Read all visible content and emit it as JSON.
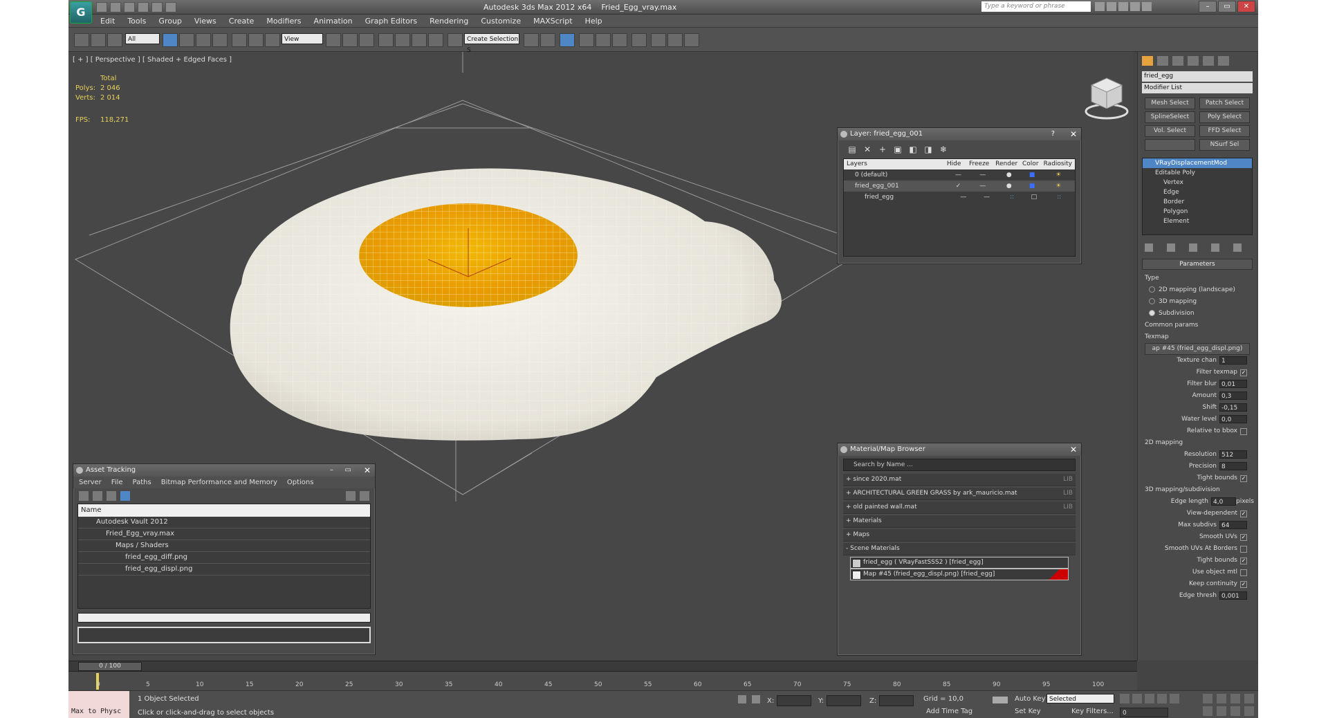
{
  "titlebar": {
    "app_title": "Autodesk 3ds Max  2012 x64",
    "file_title": "Fried_Egg_vray.max",
    "search_placeholder": "Type a keyword or phrase"
  },
  "menu": [
    "Edit",
    "Tools",
    "Group",
    "Views",
    "Create",
    "Modifiers",
    "Animation",
    "Graph Editors",
    "Rendering",
    "Customize",
    "MAXScript",
    "Help"
  ],
  "toolbar": {
    "filter_value": "All",
    "ref_coord_value": "View",
    "selection_set_value": "Create Selection S"
  },
  "viewport": {
    "label": "[ + ] [ Perspective ] [ Shaded + Edged Faces ]",
    "stats_header": "Total",
    "polys_label": "Polys:",
    "polys_value": "2 046",
    "verts_label": "Verts:",
    "verts_value": "2 014",
    "fps_label": "FPS:",
    "fps_value": "118,271"
  },
  "layer_dialog": {
    "title": "Layer: fried_egg_001",
    "columns": [
      "Layers",
      "Hide",
      "Freeze",
      "Render",
      "Color",
      "Radiosity"
    ],
    "rows": [
      {
        "name": "0 (default)"
      },
      {
        "name": "fried_egg_001"
      },
      {
        "name": "fried_egg"
      }
    ]
  },
  "material_browser": {
    "title": "Material/Map Browser",
    "search_placeholder": "Search by Name ...",
    "groups": [
      {
        "label": "+ since 2020.mat",
        "tag": "LIB"
      },
      {
        "label": "+ ARCHITECTURAL GREEN GRASS by ark_mauricio.mat",
        "tag": "LIB"
      },
      {
        "label": "+ old painted wall.mat",
        "tag": "LIB"
      },
      {
        "label": "+ Materials",
        "tag": ""
      },
      {
        "label": "+ Maps",
        "tag": ""
      },
      {
        "label": "- Scene Materials",
        "tag": ""
      }
    ],
    "scene_items": [
      "fried_egg  ( VRayFastSSS2 )  [fried_egg]",
      "Map #45 (fried_egg_displ.png) [fried_egg]"
    ]
  },
  "asset_tracking": {
    "title": "Asset Tracking",
    "menu": [
      "Server",
      "File",
      "Paths",
      "Bitmap Performance and Memory",
      "Options"
    ],
    "column": "Name",
    "rows": [
      {
        "label": "Autodesk Vault 2012"
      },
      {
        "label": "Fried_Egg_vray.max"
      },
      {
        "label": "Maps / Shaders"
      },
      {
        "label": "fried_egg_diff.png"
      },
      {
        "label": "fried_egg_displ.png"
      }
    ]
  },
  "command_panel": {
    "object_name": "fried_egg",
    "modifier_list": "Modifier List",
    "buttons": [
      "Mesh Select",
      "Patch Select",
      "SplineSelect",
      "Poly Select",
      "Vol. Select",
      "FFD Select",
      "",
      "NSurf Sel"
    ],
    "stack": {
      "selected": "VRayDisplacementMod",
      "base": "Editable Poly",
      "subs": [
        "Vertex",
        "Edge",
        "Border",
        "Polygon",
        "Element"
      ]
    },
    "params": {
      "rollout": "Parameters",
      "type_label": "Type",
      "type_options": [
        "2D mapping (landscape)",
        "3D mapping",
        "Subdivision"
      ],
      "common_label": "Common params",
      "texmap_label": "Texmap",
      "texmap_value": "ap #45 (fried_egg_displ.png)",
      "texture_chan_label": "Texture chan",
      "texture_chan_value": "1",
      "filter_texmap_label": "Filter texmap",
      "filter_blur_label": "Filter blur",
      "filter_blur_value": "0,01",
      "amount_label": "Amount",
      "amount_value": "0,3",
      "shift_label": "Shift",
      "shift_value": "-0,15",
      "water_label": "Water level",
      "water_value": "0,0",
      "relative_label": "Relative to bbox",
      "mapping2d_label": "2D mapping",
      "resolution_label": "Resolution",
      "resolution_value": "512",
      "precision_label": "Precision",
      "precision_value": "8",
      "tight_label": "Tight bounds",
      "mapping3d_label": "3D mapping/subdivision",
      "edge_length_label": "Edge length",
      "edge_length_value": "4,0",
      "pixels_label": "pixels",
      "view_dep_label": "View-dependent",
      "max_subdivs_label": "Max subdivs",
      "max_subdivs_value": "64",
      "smooth_uvs_label": "Smooth UVs",
      "smooth_uvs_borders_label": "Smooth UVs At Borders",
      "tight2_label": "Tight bounds",
      "use_obj_mtl_label": "Use object mtl",
      "keep_cont_label": "Keep continuity",
      "edge_thresh_label": "Edge thresh",
      "edge_thresh_value": "0,001"
    }
  },
  "timeline": {
    "slider": "0 / 100",
    "ticks": [
      "0",
      "5",
      "10",
      "15",
      "20",
      "25",
      "30",
      "35",
      "40",
      "45",
      "50",
      "55",
      "60",
      "65",
      "70",
      "75",
      "80",
      "85",
      "90",
      "95",
      "100"
    ]
  },
  "status": {
    "script_box": "Max to Physc",
    "selected": "1 Object Selected",
    "hint": "Click or click-and-drag to select objects",
    "x_label": "X:",
    "y_label": "Y:",
    "z_label": "Z:",
    "grid": "Grid = 10,0",
    "auto_key": "Auto Key",
    "selected_mode": "Selected",
    "set_key": "Set Key",
    "key_filters": "Key Filters...",
    "add_time_tag": "Add Time Tag",
    "frame": "0"
  }
}
